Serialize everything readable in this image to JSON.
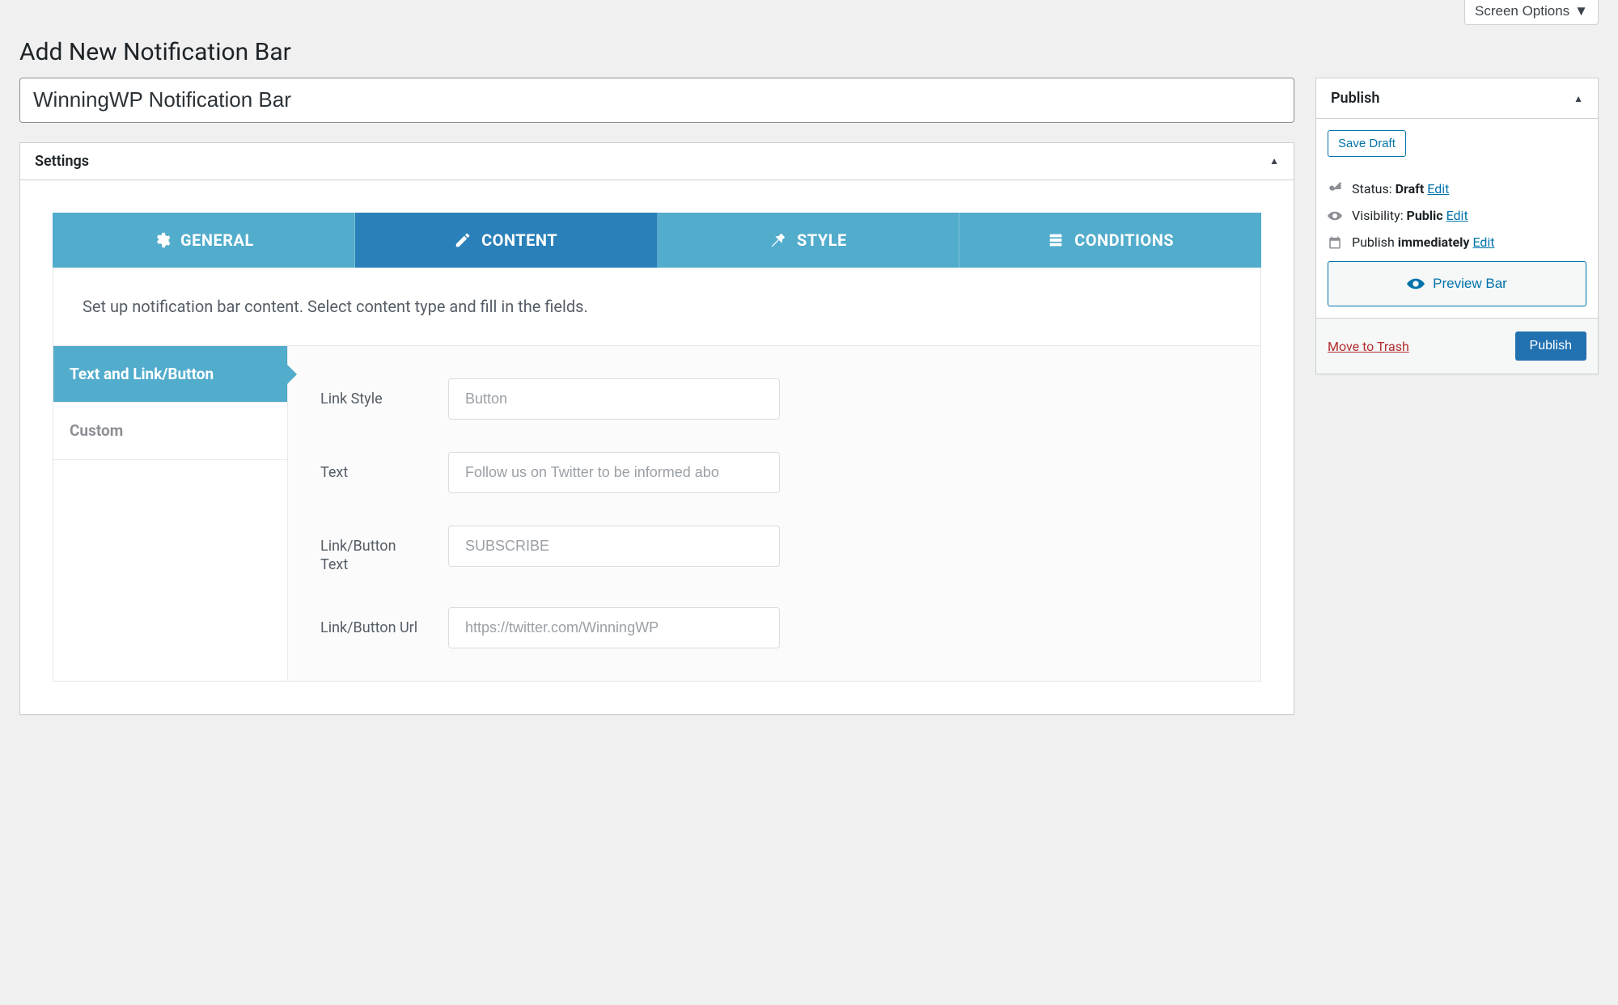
{
  "header": {
    "screen_options": "Screen Options",
    "page_title": "Add New Notification Bar"
  },
  "title_value": "WinningWP Notification Bar",
  "settings_panel": {
    "title": "Settings",
    "tabs": {
      "general": "GENERAL",
      "content": "CONTENT",
      "style": "STYLE",
      "conditions": "CONDITIONS"
    },
    "intro": "Set up notification bar content. Select content type and fill in the fields.",
    "subtabs": {
      "text_link": "Text and Link/Button",
      "custom": "Custom"
    },
    "fields": {
      "link_style": {
        "label": "Link Style",
        "value": "Button"
      },
      "text": {
        "label": "Text",
        "value": "Follow us on Twitter to be informed abo"
      },
      "link_button_text": {
        "label": "Link/Button Text",
        "value": "SUBSCRIBE"
      },
      "link_button_url": {
        "label": "Link/Button Url",
        "value": "https://twitter.com/WinningWP"
      }
    }
  },
  "publish_box": {
    "title": "Publish",
    "save_draft": "Save Draft",
    "status_label": "Status:",
    "status_value": "Draft",
    "visibility_label": "Visibility:",
    "visibility_value": "Public",
    "publish_label": "Publish",
    "publish_value": "immediately",
    "edit": "Edit",
    "preview": "Preview Bar",
    "trash": "Move to Trash",
    "publish_btn": "Publish"
  }
}
